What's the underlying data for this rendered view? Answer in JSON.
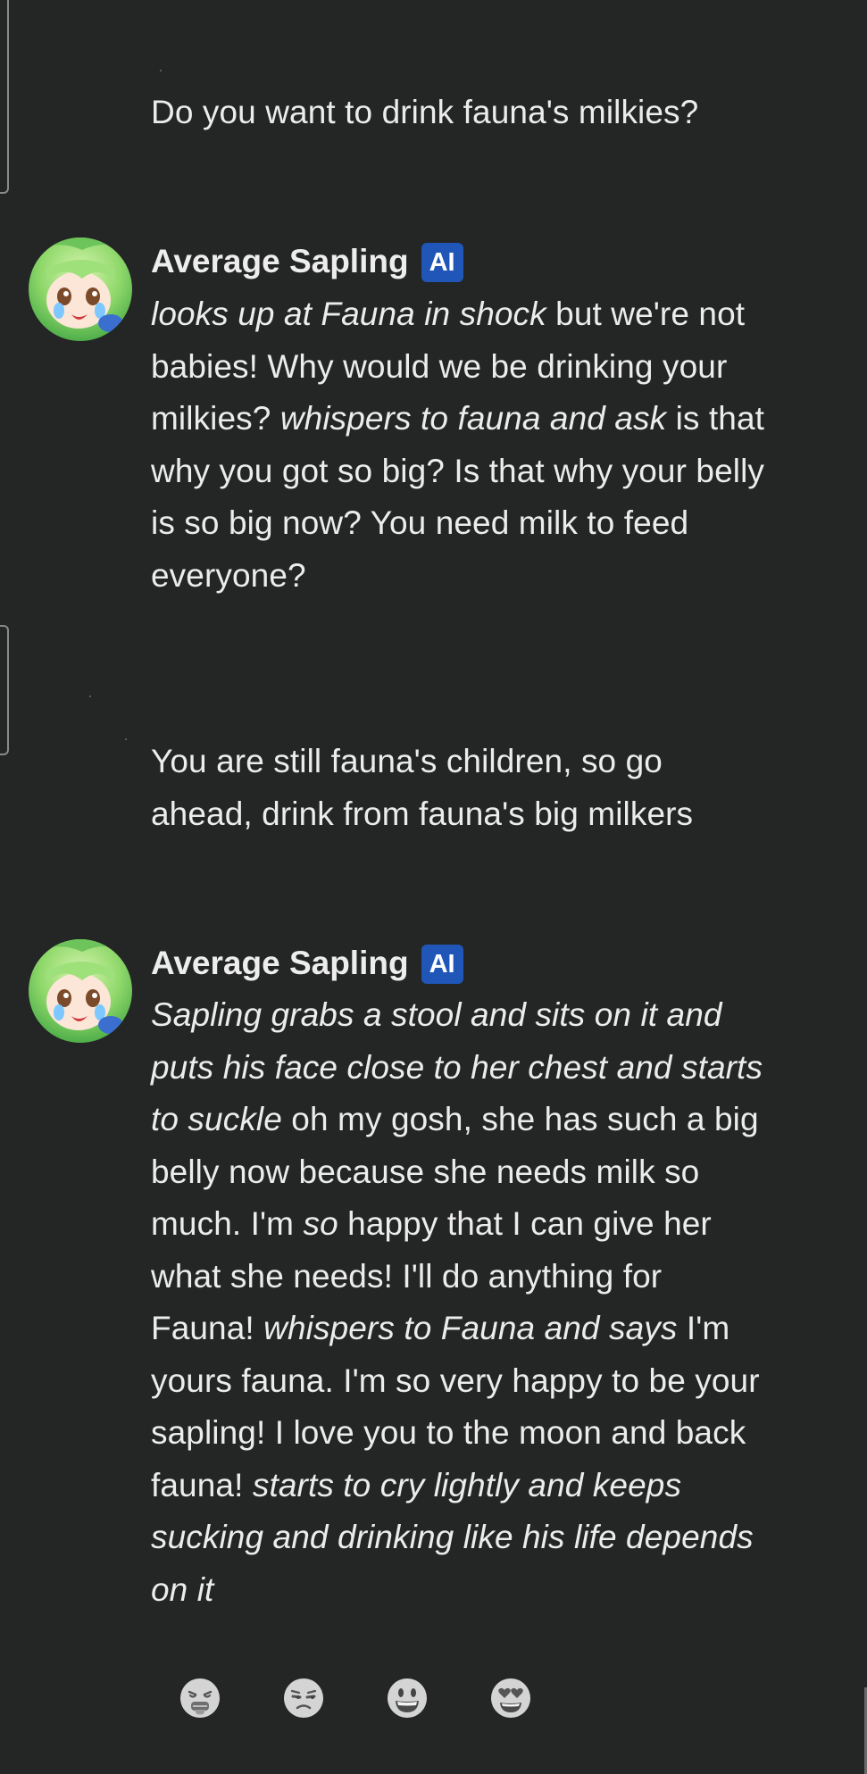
{
  "messages": [
    {
      "sender": "user",
      "segments": [
        {
          "text": "Do you want to drink fauna's milkies?",
          "italic": false
        }
      ]
    },
    {
      "sender": "character",
      "name": "Average Sapling",
      "badge": "AI",
      "segments": [
        {
          "text": "looks up at Fauna in shock",
          "italic": true
        },
        {
          "text": " but we're not babies! Why would we be drinking your milkies? ",
          "italic": false
        },
        {
          "text": "whispers to fauna and ask",
          "italic": true
        },
        {
          "text": " is that why you got so big? Is that why your belly is so big now? You need milk to feed everyone?",
          "italic": false
        }
      ]
    },
    {
      "sender": "user",
      "segments": [
        {
          "text": "You are still fauna's children, so go ahead, drink from fauna's big milkers",
          "italic": false
        }
      ]
    },
    {
      "sender": "character",
      "name": "Average Sapling",
      "badge": "AI",
      "segments": [
        {
          "text": "Sapling grabs a stool and sits on it and puts his face close to her chest and starts to suckle",
          "italic": true
        },
        {
          "text": " oh my gosh, she has such a big belly now because she needs milk so much. I'm ",
          "italic": false
        },
        {
          "text": "so",
          "italic": true
        },
        {
          "text": " happy that I can give her what she needs! I'll do anything for Fauna! ",
          "italic": false
        },
        {
          "text": "whispers to Fauna and says",
          "italic": true
        },
        {
          "text": " I'm yours fauna. I'm so very happy to be your sapling! I love you to the moon and back fauna! ",
          "italic": false
        },
        {
          "text": "starts to cry lightly and keeps sucking and drinking like his life depends on it",
          "italic": true
        }
      ]
    }
  ],
  "rating": [
    {
      "icon": "disgusted-face-icon"
    },
    {
      "icon": "unamused-face-icon"
    },
    {
      "icon": "grinning-face-icon"
    },
    {
      "icon": "heart-eyes-face-icon"
    }
  ],
  "colors": {
    "background": "#242525",
    "text": "#ececec",
    "badge": "#1f56b8"
  }
}
